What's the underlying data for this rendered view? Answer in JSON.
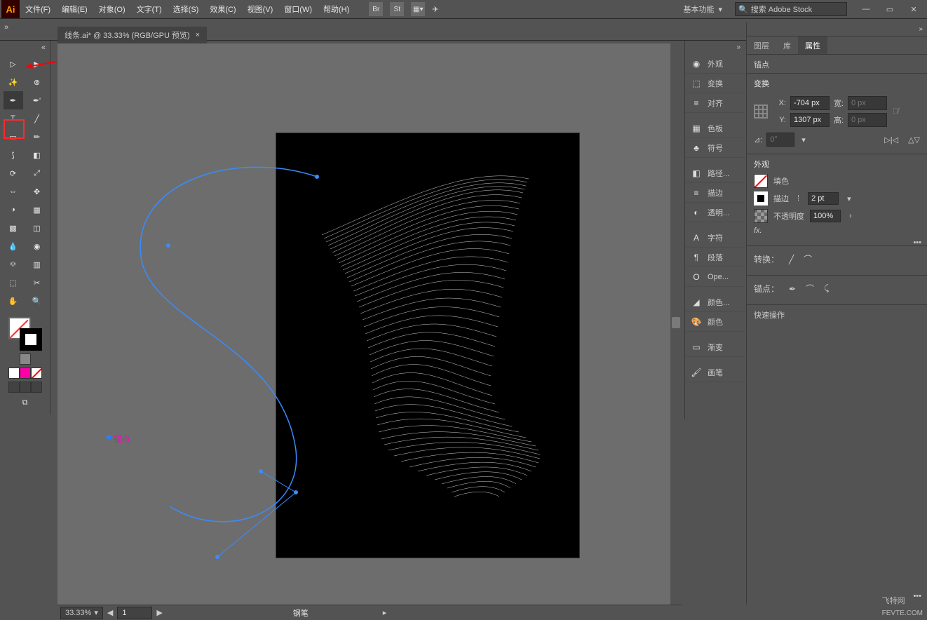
{
  "app_logo": "Ai",
  "menu": {
    "file": "文件(F)",
    "edit": "编辑(E)",
    "object": "对象(O)",
    "type": "文字(T)",
    "select": "选择(S)",
    "effect": "效果(C)",
    "view": "视图(V)",
    "window": "窗口(W)",
    "help": "帮助(H)"
  },
  "top_icons": {
    "br": "Br",
    "st": "St"
  },
  "workspace": "基本功能",
  "search_placeholder": "搜索 Adobe Stock",
  "document_tab": "线条.ai* @ 33.33% (RGB/GPU 预览)",
  "collapse_glyph": "«",
  "expand_glyph": "»",
  "panel_icons": {
    "appearance": "外观",
    "transform": "变换",
    "align": "对齐",
    "swatches": "色板",
    "symbols": "符号",
    "pathfinder": "路径...",
    "stroke": "描边",
    "transparency": "透明...",
    "character": "字符",
    "paragraph": "段落",
    "opentype": "Ope...",
    "color_guide": "颜色...",
    "color": "颜色",
    "gradient": "渐变",
    "brushes": "画笔"
  },
  "prop_tabs": {
    "layers": "图层",
    "lib": "库",
    "properties": "属性"
  },
  "properties": {
    "header": "锚点",
    "transform": {
      "title": "变换",
      "x_label": "X:",
      "y_label": "Y:",
      "w_label": "宽:",
      "h_label": "高:",
      "x": "-704 px",
      "y": "1307 px",
      "w": "0 px",
      "h": "0 px",
      "angle_label": "⊿:",
      "angle": "0°",
      "flip_h": "▷|◁",
      "flip_v": "△▽"
    },
    "appearance": {
      "title": "外观",
      "fill": "填色",
      "stroke": "描边",
      "stroke_val": "2 pt",
      "opacity": "不透明度",
      "opacity_val": "100%",
      "fx": "fx."
    },
    "convert": {
      "title": "转换：",
      "i1": "╱",
      "i2": "⌒"
    },
    "anchors": {
      "title": "锚点：",
      "i1": "✒",
      "i2": "⌒",
      "i3": "⤹"
    },
    "quick": "快速操作"
  },
  "canvas": {
    "anchor_label": "锚点"
  },
  "status": {
    "zoom": "33.33%",
    "artboard": "1",
    "tool": "钢笔"
  },
  "watermark": {
    "brand": "飞特网",
    "url": "FEVTE.COM"
  }
}
